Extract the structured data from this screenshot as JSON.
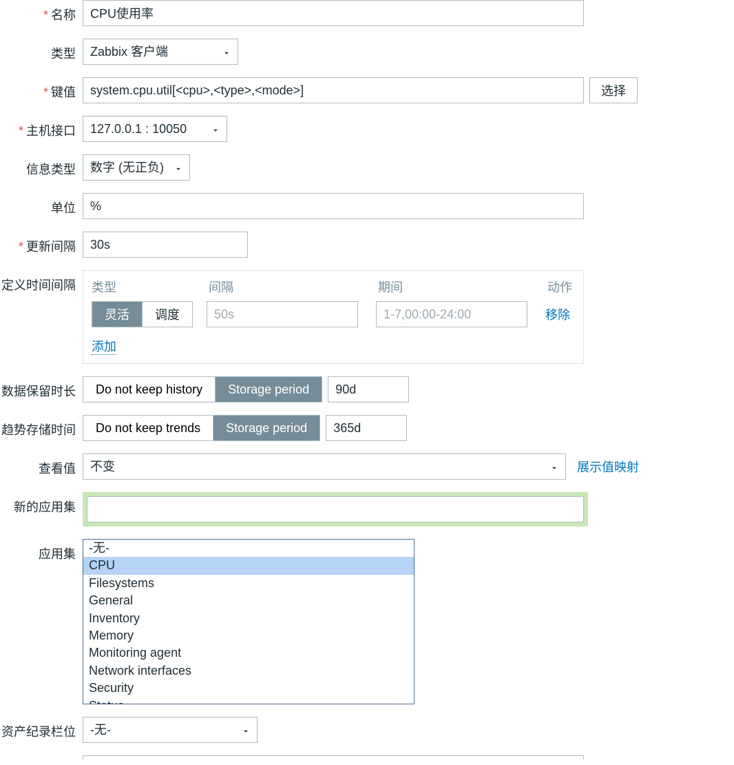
{
  "labels": {
    "name": "名称",
    "type": "类型",
    "key": "键值",
    "host_interface": "主机接口",
    "info_type": "信息类型",
    "units": "单位",
    "update_interval": "更新间隔",
    "custom_intervals": "定义时间间隔",
    "history": "数据保留时长",
    "trends": "趋势存储时间",
    "show_value": "查看值",
    "new_application": "新的应用集",
    "applications": "应用集",
    "inventory_field": "资产纪录栏位"
  },
  "values": {
    "name": "CPU使用率",
    "type": "Zabbix 客户端",
    "key": "system.cpu.util[<cpu>,<type>,<mode>]",
    "host_interface": "127.0.0.1 : 10050",
    "info_type": "数字 (无正负)",
    "units": "%",
    "update_interval": "30s",
    "history_period": "90d",
    "trends_period": "365d",
    "show_value": "不变",
    "new_application": "",
    "inventory_field": "-无-"
  },
  "buttons": {
    "select": "选择",
    "remove": "移除",
    "add": "添加",
    "show_value_mappings": "展示值映射"
  },
  "intervals": {
    "header_type": "类型",
    "header_interval": "间隔",
    "header_period": "期间",
    "header_action": "动作",
    "toggle_flexible": "灵活",
    "toggle_scheduling": "调度",
    "interval_placeholder": "50s",
    "period_placeholder": "1-7,00:00-24:00"
  },
  "history": {
    "no_keep": "Do not keep history",
    "storage": "Storage period"
  },
  "trends": {
    "no_keep": "Do not keep trends",
    "storage": "Storage period"
  },
  "applications_list": [
    "-无-",
    "CPU",
    "Filesystems",
    "General",
    "Inventory",
    "Memory",
    "Monitoring agent",
    "Network interfaces",
    "Security",
    "Status"
  ],
  "applications_selected": "CPU"
}
